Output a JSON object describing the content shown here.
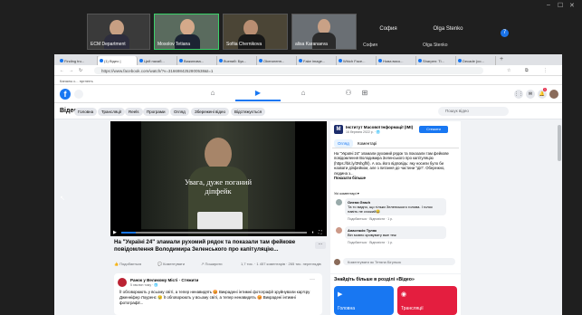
{
  "meeting": {
    "participants": [
      {
        "name": "ECM Department"
      },
      {
        "name": "Mosolov Tetiana"
      },
      {
        "name": "Sofiia Chernikova"
      },
      {
        "name": "alisa Karanaeva"
      }
    ],
    "name_only": [
      {
        "big": "София",
        "small": "София"
      },
      {
        "big": "Olga Stenko",
        "small": "Olga Stenko"
      }
    ],
    "more_label": "7",
    "window_controls": [
      "–",
      "☐",
      "✕"
    ]
  },
  "browser": {
    "tabs": [
      {
        "label": "Finding tru..."
      },
      {
        "label": "(1) Відео |"
      },
      {
        "label": "Цей нахаб..."
      },
      {
        "label": "Вижилова..."
      },
      {
        "label": "Вчений: Бук..."
      },
      {
        "label": "Oberоненн..."
      },
      {
        "label": "Fake image..."
      },
      {
        "label": "Which Face..."
      },
      {
        "label": "Нова висо..."
      },
      {
        "label": "Sharpen: Ti..."
      },
      {
        "label": "Decade (co..."
      }
    ],
    "active_tab": 1,
    "url": "https://www.facebook.com/watch/?v=3166984252800538&t=1",
    "bookmark": "Каналы с... пргнелъ"
  },
  "facebook": {
    "logo": "f",
    "nav": [
      {
        "icon": "home-icon",
        "glyph": "⌂"
      },
      {
        "icon": "video-icon",
        "glyph": "▶"
      },
      {
        "icon": "marketplace-icon",
        "glyph": "⌂"
      },
      {
        "icon": "groups-icon",
        "glyph": "⚇"
      },
      {
        "icon": "gaming-icon",
        "glyph": "⊞"
      }
    ],
    "right_buttons": [
      "⋮⋮",
      "✉",
      "🔔"
    ],
    "notification_count": "1"
  },
  "video_page": {
    "title": "Відео",
    "pills": [
      "Головна",
      "Трансляції",
      "Reels",
      "Програми",
      "Огляд",
      "Збережені відео",
      "Відстежується"
    ],
    "search_placeholder": "Пошук відео"
  },
  "player": {
    "caption_line1": "Увага, дуже поганий",
    "caption_line2": "діпфейк",
    "video_title": "На \"Україні 24\" зламали рухомий рядок та показали там фейкове повідомлення Володимира Зеленського про капітуляцію...",
    "more_label": "···",
    "reactions": [
      {
        "label": "Подобається"
      },
      {
        "label": "Коментувати"
      },
      {
        "label": "Поширити"
      }
    ],
    "stats": "1,7 тис.  ·  1 457 коментарів  ·  265 тис. переглядів"
  },
  "post": {
    "author": "Ранок у Великому Місті  · Стежити",
    "meta": "5 хвилин тому · 🌐",
    "text": "Її обговорюють у всьому світі, а тепер ненавидять 😡 Викрадені інтимні фотографії зруйнували кар'єру Дженніфер Лоуренс 😢  Її обговорюють у всьому світі, а тепер ненавидять 😡 Викрадені інтимні фотографії..."
  },
  "side": {
    "org_initial": "М",
    "org_name": "Інститут Масової Інформації (IMI)",
    "org_date": "16 березня 2022 р. · 🌐",
    "follow_label": "Стежити",
    "tabs": [
      "Огляд",
      "Коментарі"
    ],
    "description_lines": [
      "На \"Україні 24\" зламали рухомий рядок та показали там фейкове",
      "повідомлення Володимира Зеленського про капітуляцію",
      "(https://bit.ly/3Nhgfhl). А ось його відповідь: яку носили було би",
      "назвати діпфейком, але з питання до частини \"діп\". Обережно,",
      "людина з..."
    ],
    "link_text": "https://bit.ly/3Nhgfhl",
    "more_link": "Показати більше",
    "all_comments": "Усі коментарі ▾",
    "comments": [
      {
        "author": "Олена Grach",
        "text": "Та то видно, що тільки Зеленського голова. І голос навіть не схожий😂",
        "actions": "Подобається · Відповісти · 1 р."
      },
      {
        "author": "Анастасія Туляк",
        "text": "Він мовно кривувату вже теж",
        "actions": "Подобається · Відповісти · 1 р."
      }
    ],
    "comment_placeholder": "Коментувати як Тетяна Бігуньок"
  },
  "discover": {
    "title": "Знайдіть більше в розділі «Відео»",
    "cards": [
      {
        "label": "Головна",
        "icon": "▶",
        "color": "#1877f2"
      },
      {
        "label": "Трансляції",
        "icon": "◉",
        "color": "#e41e3f"
      }
    ]
  }
}
